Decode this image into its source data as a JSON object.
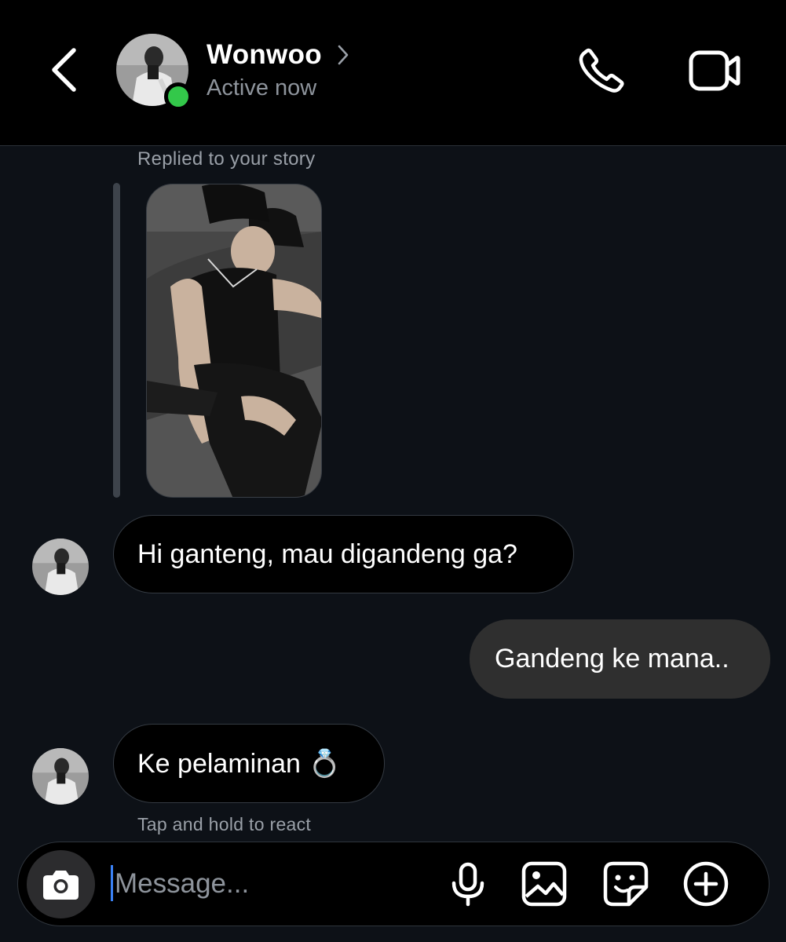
{
  "header": {
    "contact_name": "Wonwoo",
    "status": "Active now",
    "icons": [
      "back-icon",
      "chevron-right-icon",
      "phone-icon",
      "video-camera-icon"
    ],
    "online_color": "#33c84a"
  },
  "thread": {
    "reply_caption": "Replied to your story",
    "messages": [
      {
        "from": "contact",
        "text": "Hi ganteng, mau digandeng ga?"
      },
      {
        "from": "me",
        "text": "Gandeng ke mana.."
      },
      {
        "from": "contact",
        "text": "Ke pelaminan 💍"
      }
    ],
    "hint": "Tap and hold to react"
  },
  "composer": {
    "placeholder": "Message...",
    "icons": [
      "camera-icon",
      "microphone-icon",
      "gallery-icon",
      "sticker-icon",
      "plus-circle-icon"
    ],
    "caret_color": "#3b82f6"
  }
}
